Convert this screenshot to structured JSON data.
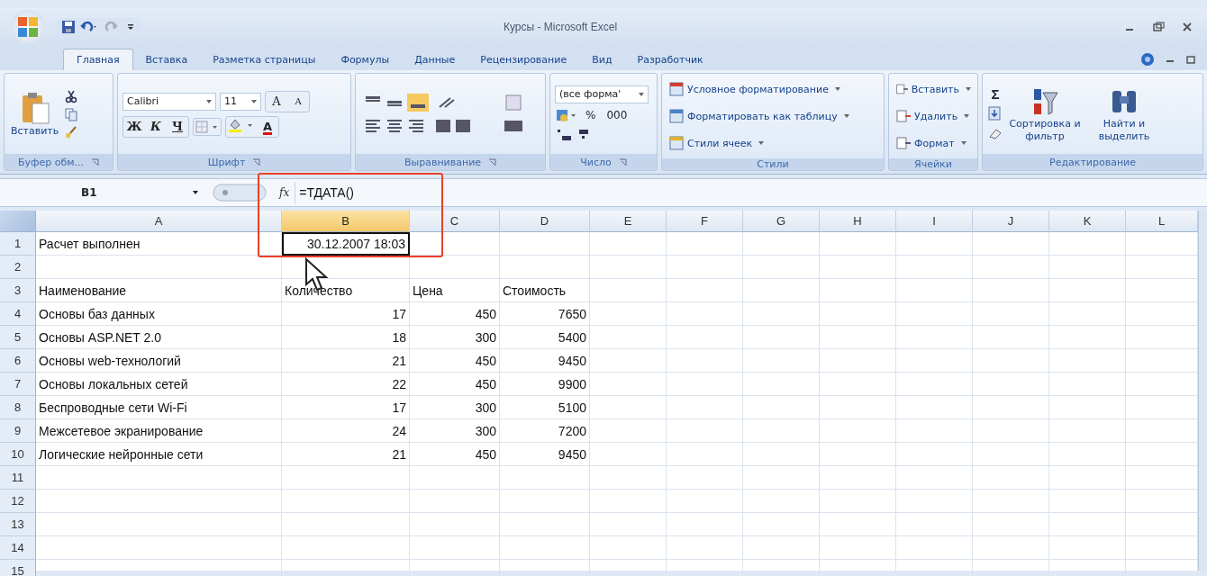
{
  "window": {
    "title": "Курсы - Microsoft Excel"
  },
  "tabs": [
    {
      "label": "Главная",
      "selected": true
    },
    {
      "label": "Вставка",
      "selected": false
    },
    {
      "label": "Разметка страницы",
      "selected": false
    },
    {
      "label": "Формулы",
      "selected": false
    },
    {
      "label": "Данные",
      "selected": false
    },
    {
      "label": "Рецензирование",
      "selected": false
    },
    {
      "label": "Вид",
      "selected": false
    },
    {
      "label": "Разработчик",
      "selected": false
    }
  ],
  "ribbon": {
    "clipboard": {
      "paste": "Вставить",
      "label": "Буфер обм..."
    },
    "font": {
      "name": "Calibri",
      "size": "11",
      "grow": "A",
      "shrink": "A",
      "bold": "Ж",
      "italic": "К",
      "underline": "Ч",
      "color_letter": "A",
      "label": "Шрифт"
    },
    "alignment": {
      "label": "Выравнивание"
    },
    "number": {
      "format": "(все форма'",
      "percent": "%",
      "thousands": "000",
      "label": "Число"
    },
    "styles": {
      "items": [
        "Условное форматирование",
        "Форматировать как таблицу",
        "Стили ячеек"
      ],
      "label": "Стили"
    },
    "cells": {
      "items": [
        "Вставить",
        "Удалить",
        "Формат"
      ],
      "label": "Ячейки"
    },
    "editing": {
      "sum": "Σ",
      "sort": "Сортировка и фильтр",
      "find": "Найти и выделить",
      "label": "Редактирование"
    }
  },
  "formula_bar": {
    "name_box": "B1",
    "fx": "fx",
    "formula": "=ТДАТА()"
  },
  "columns": [
    {
      "label": "A",
      "selected": false
    },
    {
      "label": "B",
      "selected": true
    },
    {
      "label": "C",
      "selected": false
    },
    {
      "label": "D",
      "selected": false
    },
    {
      "label": "E",
      "selected": false
    },
    {
      "label": "F",
      "selected": false
    },
    {
      "label": "G",
      "selected": false
    },
    {
      "label": "H",
      "selected": false
    },
    {
      "label": "I",
      "selected": false
    },
    {
      "label": "J",
      "selected": false
    },
    {
      "label": "K",
      "selected": false
    },
    {
      "label": "L",
      "selected": false
    }
  ],
  "rows": [
    {
      "number": "1",
      "cells": [
        {
          "text": "Расчет выполнен",
          "kind": "text",
          "selected": false
        },
        {
          "text": "30.12.2007 18:03",
          "kind": "number",
          "selected": true
        },
        null,
        null
      ]
    },
    {
      "number": "2",
      "cells": [
        null,
        null,
        null,
        null
      ]
    },
    {
      "number": "3",
      "cells": [
        {
          "text": "Наименование",
          "kind": "text",
          "selected": false
        },
        {
          "text": "Количество",
          "kind": "text",
          "selected": false
        },
        {
          "text": "Цена",
          "kind": "text",
          "selected": false
        },
        {
          "text": "Стоимость",
          "kind": "text",
          "selected": false
        }
      ]
    },
    {
      "number": "4",
      "cells": [
        {
          "text": "Основы баз данных",
          "kind": "text",
          "selected": false
        },
        {
          "text": "17",
          "kind": "number",
          "selected": false
        },
        {
          "text": "450",
          "kind": "number",
          "selected": false
        },
        {
          "text": "7650",
          "kind": "number",
          "selected": false
        }
      ]
    },
    {
      "number": "5",
      "cells": [
        {
          "text": "Основы ASP.NET 2.0",
          "kind": "text",
          "selected": false
        },
        {
          "text": "18",
          "kind": "number",
          "selected": false
        },
        {
          "text": "300",
          "kind": "number",
          "selected": false
        },
        {
          "text": "5400",
          "kind": "number",
          "selected": false
        }
      ]
    },
    {
      "number": "6",
      "cells": [
        {
          "text": "Основы web-технологий",
          "kind": "text",
          "selected": false
        },
        {
          "text": "21",
          "kind": "number",
          "selected": false
        },
        {
          "text": "450",
          "kind": "number",
          "selected": false
        },
        {
          "text": "9450",
          "kind": "number",
          "selected": false
        }
      ]
    },
    {
      "number": "7",
      "cells": [
        {
          "text": "Основы локальных сетей",
          "kind": "text",
          "selected": false
        },
        {
          "text": "22",
          "kind": "number",
          "selected": false
        },
        {
          "text": "450",
          "kind": "number",
          "selected": false
        },
        {
          "text": "9900",
          "kind": "number",
          "selected": false
        }
      ]
    },
    {
      "number": "8",
      "cells": [
        {
          "text": "Беспроводные сети Wi-Fi",
          "kind": "text",
          "selected": false
        },
        {
          "text": "17",
          "kind": "number",
          "selected": false
        },
        {
          "text": "300",
          "kind": "number",
          "selected": false
        },
        {
          "text": "5100",
          "kind": "number",
          "selected": false
        }
      ]
    },
    {
      "number": "9",
      "cells": [
        {
          "text": "Межсетевое экранирование",
          "kind": "text",
          "selected": false
        },
        {
          "text": "24",
          "kind": "number",
          "selected": false
        },
        {
          "text": "300",
          "kind": "number",
          "selected": false
        },
        {
          "text": "7200",
          "kind": "number",
          "selected": false
        }
      ]
    },
    {
      "number": "10",
      "cells": [
        {
          "text": "Логические нейронные сети",
          "kind": "text",
          "selected": false
        },
        {
          "text": "21",
          "kind": "number",
          "selected": false
        },
        {
          "text": "450",
          "kind": "number",
          "selected": false
        },
        {
          "text": "9450",
          "kind": "number",
          "selected": false
        }
      ]
    },
    {
      "number": "11",
      "cells": [
        null,
        null,
        null,
        null
      ]
    },
    {
      "number": "12",
      "cells": [
        null,
        null,
        null,
        null
      ]
    },
    {
      "number": "13",
      "cells": [
        null,
        null,
        null,
        null
      ]
    },
    {
      "number": "14",
      "cells": [
        null,
        null,
        null,
        null
      ]
    },
    {
      "number": "15",
      "cells": [
        null,
        null,
        null,
        null
      ]
    }
  ]
}
